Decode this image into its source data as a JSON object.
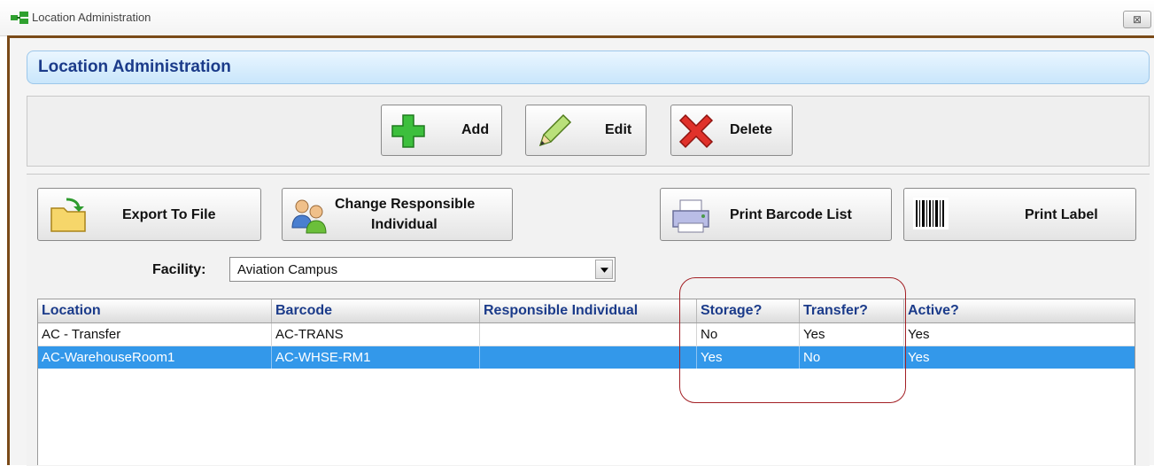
{
  "window": {
    "title": "Location Administration",
    "close_glyph": "⊠"
  },
  "header": {
    "title": "Location Administration"
  },
  "toolbar": {
    "add_label": "Add",
    "edit_label": "Edit",
    "delete_label": "Delete"
  },
  "actions": {
    "export_label": "Export To File",
    "change_responsible_line1": "Change Responsible",
    "change_responsible_line2": "Individual",
    "print_barcode_label": "Print Barcode List",
    "print_label": "Print Label"
  },
  "filter": {
    "facility_label": "Facility:",
    "facility_value": "Aviation Campus"
  },
  "grid": {
    "columns": [
      "Location",
      "Barcode",
      "Responsible Individual",
      "Storage?",
      "Transfer?",
      "Active?"
    ],
    "rows": [
      [
        "AC - Transfer",
        "AC-TRANS",
        "",
        "No",
        "Yes",
        "Yes"
      ],
      [
        "AC-WarehouseRoom1",
        "AC-WHSE-RM1",
        "",
        "Yes",
        "No",
        "Yes"
      ]
    ],
    "selected_row": 1
  },
  "colors": {
    "accent": "#3398ea",
    "header_text": "#1b3b8a",
    "annotation": "#a31f24",
    "frame": "#7a4a18"
  },
  "icons": [
    "app-icon",
    "add-icon",
    "edit-pencil-icon",
    "delete-x-icon",
    "export-folder-icon",
    "people-icon",
    "printer-icon",
    "barcode-icon",
    "dropdown-arrow-icon"
  ]
}
